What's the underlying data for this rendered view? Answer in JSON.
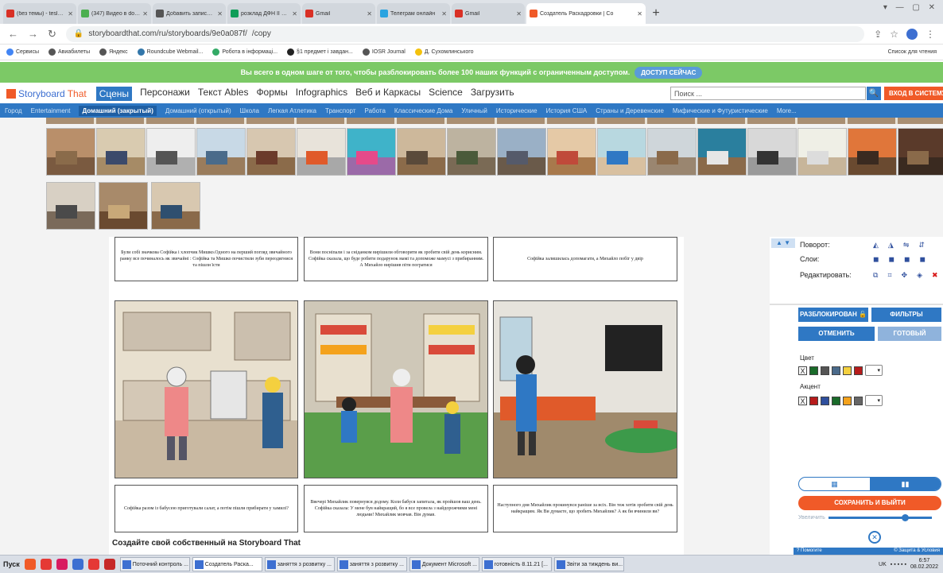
{
  "browser": {
    "tabs": [
      {
        "title": "(без темы) - teslenkosvetlana",
        "color": "#d93025",
        "active": false
      },
      {
        "title": "(347) Видео в doshkilna_mot",
        "color": "#4caf50",
        "active": false
      },
      {
        "title": "Добавить запись - Факультет",
        "color": "#555555",
        "active": false
      },
      {
        "title": "розклад ДФН II сем 2021-2022",
        "color": "#0f9d58",
        "active": false
      },
      {
        "title": "Gmail",
        "color": "#d93025",
        "active": false
      },
      {
        "title": "Телеграм онлайн",
        "color": "#2aa3e0",
        "active": false
      },
      {
        "title": "Gmail",
        "color": "#d93025",
        "active": false
      },
      {
        "title": "Создатель Раскадровки | Co",
        "color": "#f05a28",
        "active": true
      }
    ],
    "new_tab": "+",
    "url": "storyboardthat.com/ru/storyboards/9e0a087f/",
    "url_suffix": "/copy",
    "bookmarks": [
      {
        "label": "Сервисы",
        "color": "#4285f4"
      },
      {
        "label": "Авиабилеты",
        "color": "#555"
      },
      {
        "label": "Яндекс",
        "color": "#555"
      },
      {
        "label": "Roundcube Webmail...",
        "color": "#37a"
      },
      {
        "label": "Робота в інформаці...",
        "color": "#3a6"
      },
      {
        "label": "§1 предмет і завдан...",
        "color": "#222"
      },
      {
        "label": "IOSR Journal",
        "color": "#555"
      },
      {
        "label": "Д. Сухомлинського",
        "color": "#f4c20d"
      }
    ],
    "other_bookmarks": "Список для чтения"
  },
  "promo": {
    "text": "Вы всего в одном шаге от того, чтобы разблокировать более 100 наших функций с ограниченным доступом.",
    "button": "ДОСТУП СЕЙЧАС"
  },
  "nav": {
    "logo_a": "Storyboard",
    "logo_b": "That",
    "items": [
      "Сцены",
      "Персонажи",
      "Текст Ables",
      "Формы",
      "Infographics",
      "Веб и Каркасы",
      "Science",
      "Загрузить"
    ],
    "search_placeholder": "Поиск ...",
    "login": "ВХОД В СИСТЕМУ"
  },
  "categories": [
    "Город",
    "Entertainment",
    "Домашний (закрытый)",
    "Домашний (открытый)",
    "Школа",
    "Легкая Атлетика",
    "Транспорт",
    "Работа",
    "Классические Дома",
    "Уличный",
    "Исторические",
    "История США",
    "Страны и Деревенские",
    "Мифические и Футуристические",
    "More..."
  ],
  "thumbnails_row1": [
    {
      "wall": "#b98f6a",
      "floor": "#7a5a40",
      "obj": "#8a6b4a"
    },
    {
      "wall": "#d9cbb0",
      "floor": "#a68b66",
      "obj": "#3b4a6b"
    },
    {
      "wall": "#eeeeee",
      "floor": "#b0b0b0",
      "obj": "#555555"
    },
    {
      "wall": "#c8d9e6",
      "floor": "#9a7c5c",
      "obj": "#4a6b8a"
    },
    {
      "wall": "#d7c7b0",
      "floor": "#8b6b4a",
      "obj": "#6b3b2b"
    },
    {
      "wall": "#e8e3da",
      "floor": "#a8a8a8",
      "obj": "#e05a2a"
    },
    {
      "wall": "#3fb3c9",
      "floor": "#9b6aa8",
      "obj": "#e54a8a"
    },
    {
      "wall": "#cdb89b",
      "floor": "#8b6b4a",
      "obj": "#5a4a3a"
    },
    {
      "wall": "#bdb3a0",
      "floor": "#7a6a55",
      "obj": "#4a5a3a"
    },
    {
      "wall": "#9ab0c6",
      "floor": "#6a5a4a",
      "obj": "#555a6a"
    },
    {
      "wall": "#e5c9a6",
      "floor": "#a8794c",
      "obj": "#c04a3a"
    },
    {
      "wall": "#b8d8e0",
      "floor": "#d8c0a0",
      "obj": "#2f78c4"
    },
    {
      "wall": "#cfd6da",
      "floor": "#9a8670",
      "obj": "#8a6a4a"
    },
    {
      "wall": "#2a7f9e",
      "floor": "#8a6a4a",
      "obj": "#e6e6e6"
    },
    {
      "wall": "#d8d8d8",
      "floor": "#9a9a9a",
      "obj": "#333333"
    },
    {
      "wall": "#efefe6",
      "floor": "#c7b59a",
      "obj": "#dcdcdc"
    },
    {
      "wall": "#e0763a",
      "floor": "#6a4a30",
      "obj": "#3a2a20"
    },
    {
      "wall": "#5a3a2a",
      "floor": "#3a2a20",
      "obj": "#8a6a4a"
    }
  ],
  "thumbnails_row2": [
    {
      "wall": "#d8d0c4",
      "floor": "#7a6a5a",
      "obj": "#4a4a4a"
    },
    {
      "wall": "#a88a6a",
      "floor": "#6a4a30",
      "obj": "#c8a878"
    },
    {
      "wall": "#d8c8b0",
      "floor": "#8a6a4a",
      "obj": "#2f4f6f"
    }
  ],
  "storyboard": {
    "top_texts": [
      "Були собі значкова Софійка і хлопчик Мишко.Одного на перший погляд звичайного ранку все починалось як звичайні : Софійка та Мишко почистили зуби переодягнися та пішли їсти",
      "Вони посніпали і за сніданком вирішили обговорити як зробити свій день корисним. Софійка сказала, що буде робити подарунок мамі та допоможе мамусі з прибиранням. А Михайло вирішив піти погратися",
      "Софійка залишилась допомагати, а Михайло побіг у двір"
    ],
    "bottom_texts": [
      "Софійка разом із бабусею приготували салат, а потім пішли прибирати у хамилі?",
      "Ввечері Михайлик повернувся додому. Коли бабуся запитала, як пройшов ваш день. Софійка сказала: У мене був найкращий, бо я все провела з найдорожчими мені людьми! Михайлик мовчав. Він думав.",
      "Наступного дня Михайлик прокинувся раніше за всіх. Він теж хотів зробити свій день найкращим. Як Ви думаєте, що зробить Михайлик? А як би вчинили ви?"
    ],
    "footer": "Создайте свой собственный на Storyboard That"
  },
  "panel": {
    "arrows": "▲ ▼",
    "rotation_label": "Поворот:",
    "layers_label": "Слои:",
    "edit_label": "Редактировать:",
    "unlock_btn": "РАЗБЛОКИРОВАН 🔓",
    "filters_btn": "ФИЛЬТРЫ",
    "cancel_btn": "ОТМЕНИТЬ",
    "ready_btn": "ГОТОВЫЙ",
    "color_label": "Цвет",
    "accent_label": "Акцент",
    "color_swatches": [
      "#1a6b2a",
      "#555555",
      "#4a6a8a",
      "#f4d03f",
      "#b71c1c"
    ],
    "accent_swatches": [
      "#b71c1c",
      "#2f4f9d",
      "#1a6b2a",
      "#f4a21c",
      "#666666"
    ],
    "save_btn": "СОХРАНИТЬ И ВЫЙТИ",
    "zoom_label": "Увеличить",
    "help": "? Помогите",
    "protect": "© Защита & Условия"
  },
  "taskbar": {
    "start": "Пуск",
    "tasks": [
      {
        "label": "Поточний контроль ...",
        "active": false
      },
      {
        "label": "Создатель Раска...",
        "active": true
      },
      {
        "label": "заняття з розвитку ...",
        "active": false
      },
      {
        "label": "заняття з розвитку ...",
        "active": false
      },
      {
        "label": "Документ Microsoft ...",
        "active": false
      },
      {
        "label": "готовність 8.11.21 [...",
        "active": false
      },
      {
        "label": "Звіти за тиждень ви...",
        "active": false
      }
    ],
    "lang": "UK",
    "time": "6:57",
    "date": "08.02.2022"
  }
}
